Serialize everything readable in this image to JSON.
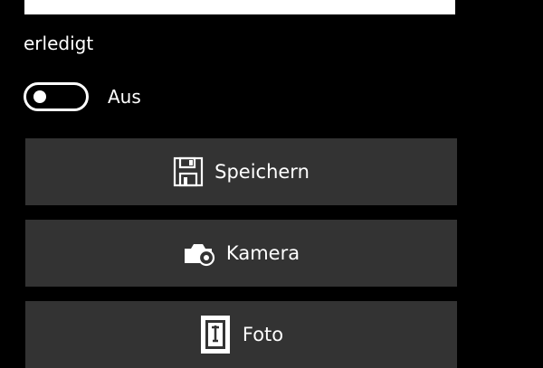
{
  "form": {
    "text_value": "",
    "done_label": "erledigt",
    "toggle_state_label": "Aus",
    "toggle_on": false
  },
  "buttons": {
    "save_label": "Speichern",
    "camera_label": "Kamera",
    "photo_label": "Foto"
  },
  "icons": {
    "save": "floppy-disk-icon",
    "camera": "camera-icon",
    "photo": "picture-frame-icon"
  },
  "colors": {
    "background": "#000000",
    "button_bg": "#333333",
    "foreground": "#ffffff"
  }
}
